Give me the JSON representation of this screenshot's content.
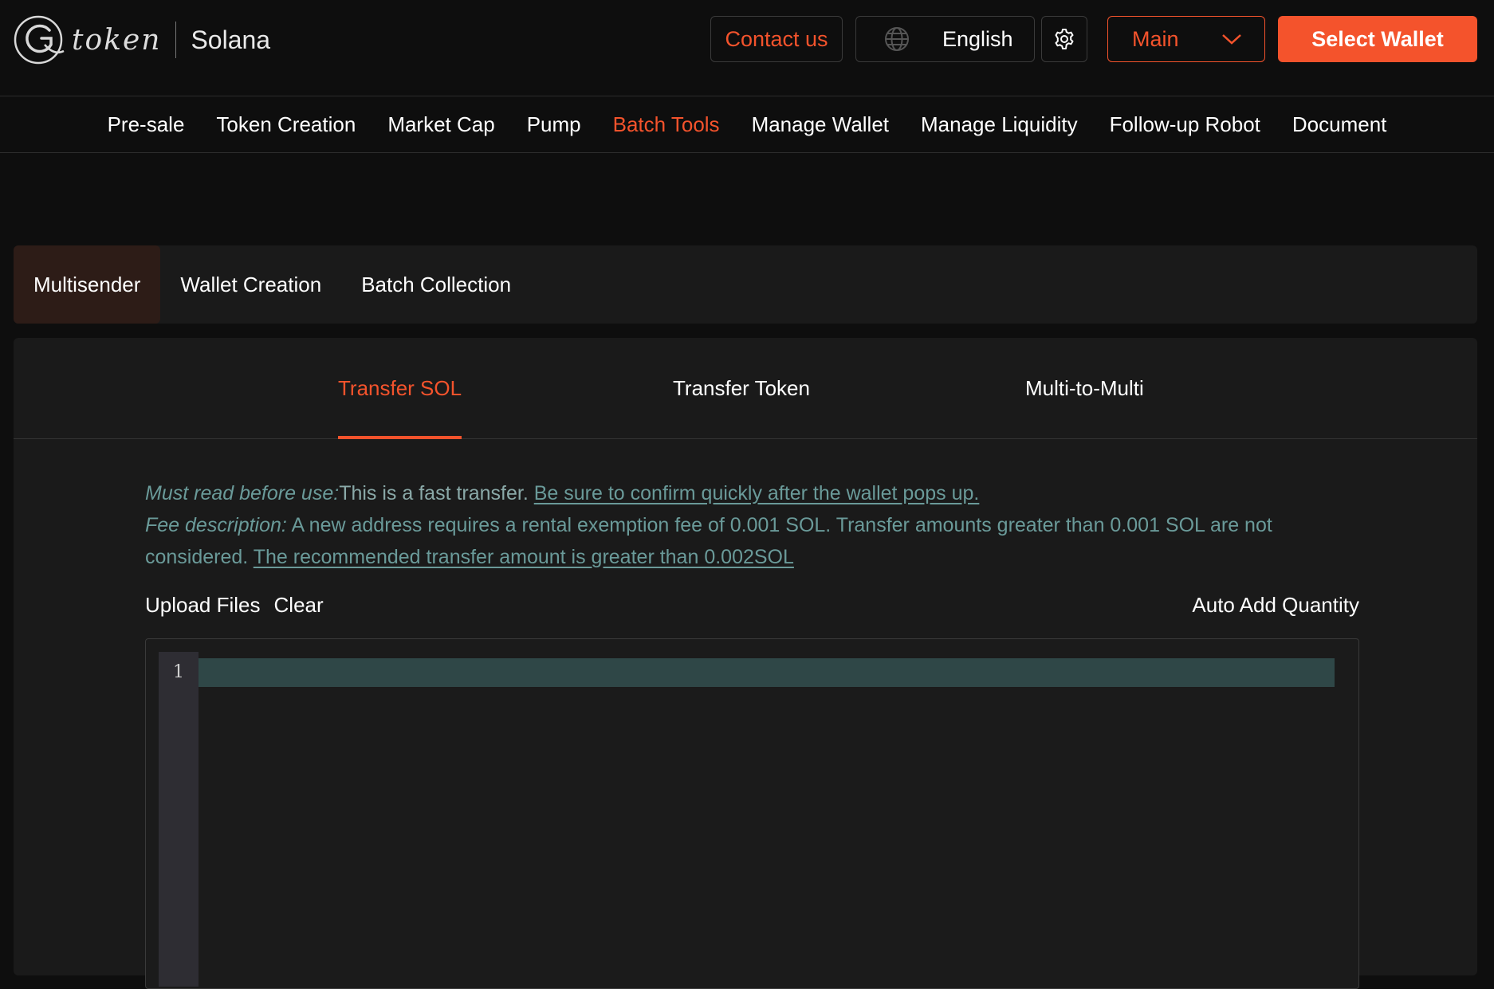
{
  "header": {
    "logo_word": "token",
    "chain": "Solana",
    "contact_label": "Contact us",
    "language_label": "English",
    "network_label": "Main",
    "wallet_label": "Select Wallet"
  },
  "nav": {
    "items": [
      "Pre-sale",
      "Token Creation",
      "Market Cap",
      "Pump",
      "Batch Tools",
      "Manage Wallet",
      "Manage Liquidity",
      "Follow-up Robot",
      "Document"
    ],
    "active": "Batch Tools"
  },
  "tool_tabs": {
    "items": [
      "Multisender",
      "Wallet Creation",
      "Batch Collection"
    ],
    "active": "Multisender"
  },
  "sub_tabs": {
    "items": [
      "Transfer SOL",
      "Transfer Token",
      "Multi-to-Multi"
    ],
    "active": "Transfer SOL"
  },
  "notice": {
    "lead1": "Must read before use:",
    "text1": "This is a fast transfer. ",
    "link1": "Be sure to confirm quickly after the wallet pops up.",
    "lead2": "Fee description:",
    "text2": " A new address requires a rental exemption fee of 0.001 SOL. Transfer amounts greater than 0.001 SOL are not considered. ",
    "link2": "The recommended transfer amount is greater than 0.002SOL"
  },
  "toolbar": {
    "upload_label": "Upload Files",
    "clear_label": "Clear",
    "auto_add_label": "Auto Add Quantity"
  },
  "editor": {
    "line_number": "1"
  },
  "colors": {
    "accent": "#f4532c",
    "background": "#0e0e0e",
    "panel": "#1a1a1a",
    "notice_text": "#6a9a99"
  },
  "icons": {
    "globe": "globe-icon",
    "settings": "gear-icon",
    "dropdown": "chevron-down-icon"
  }
}
